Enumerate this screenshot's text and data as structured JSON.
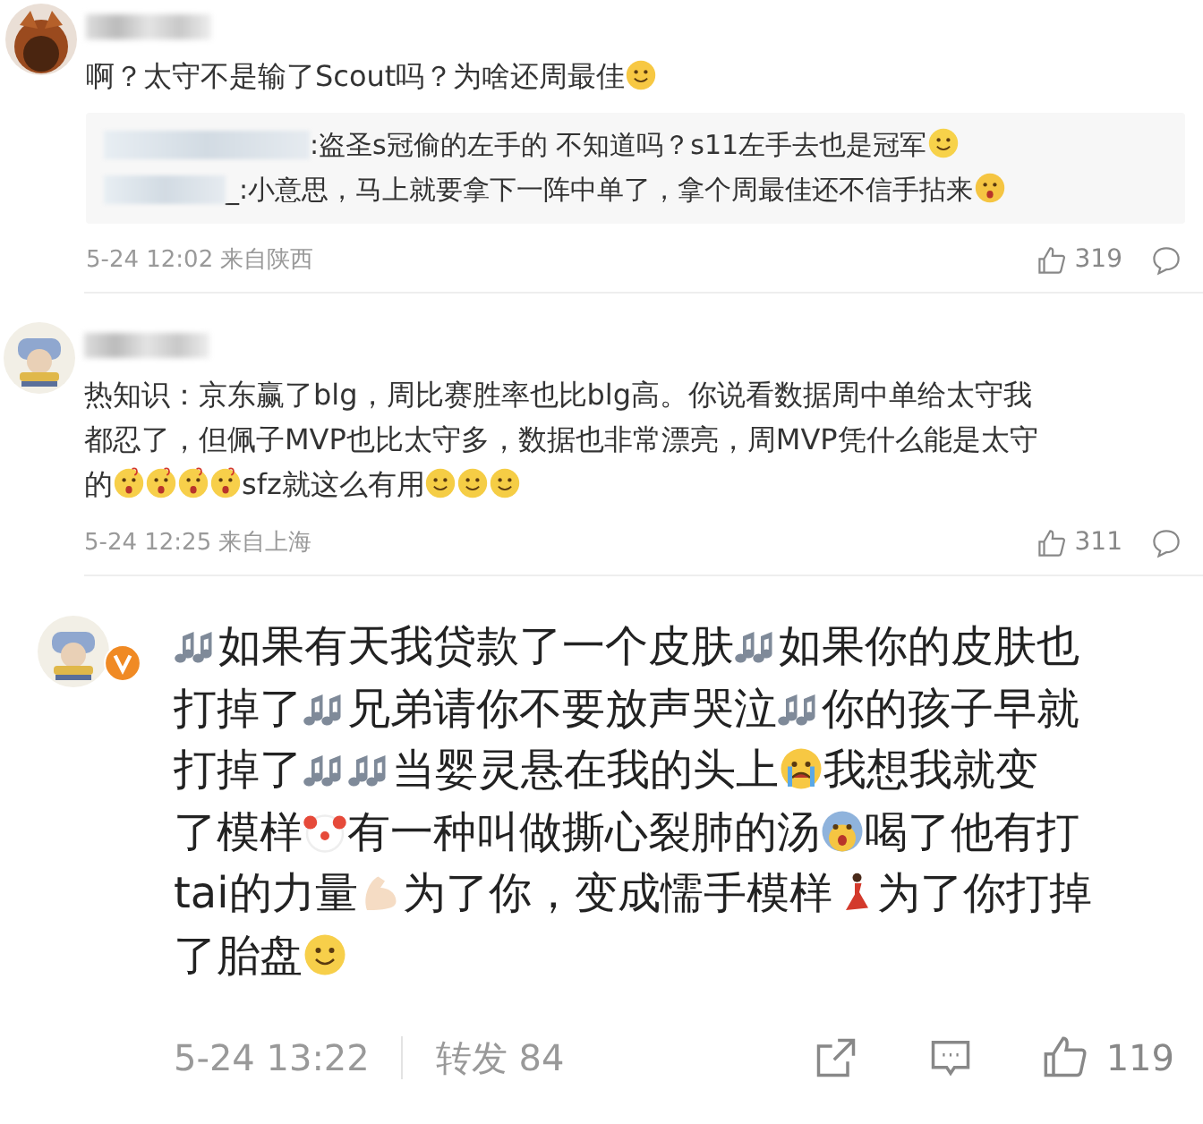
{
  "comments": [
    {
      "kind": "compact",
      "verified": false,
      "avatar": {
        "kind": "picture"
      },
      "lines": [
        [
          {
            "kind": "text",
            "text": "啊？太守不是输了Scout吗？为啥还周最佳"
          },
          {
            "kind": "laugh"
          }
        ]
      ],
      "replies": [
        {
          "content": [
            {
              "kind": "text",
              "text": ":盗圣s冠偷的左手的 不知道吗？s11左手去也是冠军"
            },
            {
              "kind": "smile"
            }
          ]
        },
        {
          "content": [
            {
              "kind": "text",
              "text": "_:小意思，马上就要拿下一阵中单了，拿个周最佳还不信手拈来"
            },
            {
              "kind": "surprised"
            }
          ]
        }
      ],
      "meta": "5-24 12:02 来自陕西",
      "likes": "319"
    },
    {
      "kind": "compact",
      "verified": false,
      "avatar": {
        "kind": "picture"
      },
      "lines": [
        [
          {
            "kind": "text",
            "text": "热知识：京东赢了blg，周比赛胜率也比blg高。你说看数据周中单给太守我"
          }
        ],
        [
          {
            "kind": "text",
            "text": "都忍了，但佩子MVP也比太守多，数据也非常漂亮，周MVP凭什么能是太守"
          }
        ],
        [
          {
            "kind": "text",
            "text": "的"
          },
          {
            "kind": "question"
          },
          {
            "kind": "question"
          },
          {
            "kind": "question"
          },
          {
            "kind": "question"
          },
          {
            "kind": "text",
            "text": "sfz就这么有用"
          },
          {
            "kind": "dizzy"
          },
          {
            "kind": "dizzy"
          },
          {
            "kind": "dizzy"
          }
        ]
      ],
      "meta": "5-24 12:25 来自上海",
      "likes": "311"
    },
    {
      "kind": "featured",
      "verified": true,
      "avatar": {
        "kind": "picture"
      },
      "lines": [
        [
          {
            "kind": "notes"
          },
          {
            "kind": "text",
            "text": "如果有天我贷款了一个皮肤"
          },
          {
            "kind": "notes"
          },
          {
            "kind": "text",
            "text": "如果你的皮肤也"
          }
        ],
        [
          {
            "kind": "text",
            "text": "打掉了"
          },
          {
            "kind": "notes"
          },
          {
            "kind": "text",
            "text": "兄弟请你不要放声哭泣"
          },
          {
            "kind": "notes"
          },
          {
            "kind": "text",
            "text": "你的孩子早就"
          }
        ],
        [
          {
            "kind": "text",
            "text": "打掉了"
          },
          {
            "kind": "notes"
          },
          {
            "kind": "notes"
          },
          {
            "kind": "text",
            "text": "当婴灵悬在我的头上"
          },
          {
            "kind": "cry"
          },
          {
            "kind": "text",
            "text": "我想我就变"
          }
        ],
        [
          {
            "kind": "text",
            "text": "了模样"
          },
          {
            "kind": "clown"
          },
          {
            "kind": "text",
            "text": "有一种叫做撕心裂肺的汤"
          },
          {
            "kind": "fear"
          },
          {
            "kind": "text",
            "text": "喝了他有打"
          }
        ],
        [
          {
            "kind": "text",
            "text": "tai的力量"
          },
          {
            "kind": "muscle"
          },
          {
            "kind": "text",
            "text": "为了你，变成懦手模样"
          },
          {
            "kind": "dancer"
          },
          {
            "kind": "text",
            "text": "为了你打掉"
          }
        ],
        [
          {
            "kind": "text",
            "text": "了胎盘"
          },
          {
            "kind": "blush"
          }
        ]
      ],
      "time": "5-24 13:22",
      "forward": "转发 84",
      "likes": "119"
    }
  ]
}
